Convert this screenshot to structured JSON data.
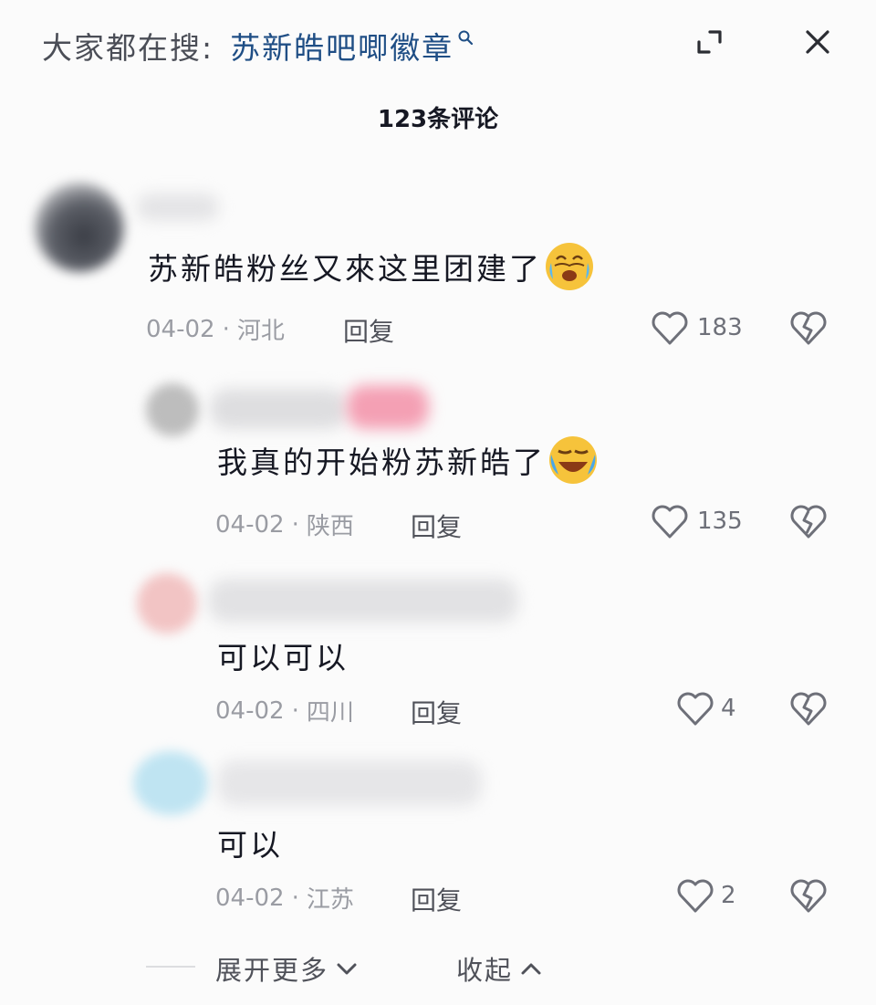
{
  "header": {
    "search_prefix": "大家都在搜:",
    "search_term": "苏新皓吧唧徽章",
    "comment_count": "123条评论"
  },
  "comments": [
    {
      "text": "苏新皓粉丝又來这里团建了",
      "emoji": "crying-laughing-emoji",
      "date": "04-02",
      "location": "河北",
      "reply": "回复",
      "likes": "183"
    },
    {
      "text": "我真的开始粉苏新皓了",
      "emoji": "sobbing-emoji",
      "date": "04-02",
      "location": "陕西",
      "reply": "回复",
      "likes": "135"
    },
    {
      "text": "可以可以",
      "date": "04-02",
      "location": "四川",
      "reply": "回复",
      "likes": "4"
    },
    {
      "text": "可以",
      "date": "04-02",
      "location": "江苏",
      "reply": "回复",
      "likes": "2"
    }
  ],
  "footer": {
    "expand_more": "展开更多",
    "collapse": "收起"
  },
  "colors": {
    "search_term": "#1f4e85",
    "meta": "#9a9ca3",
    "text": "#161823"
  }
}
